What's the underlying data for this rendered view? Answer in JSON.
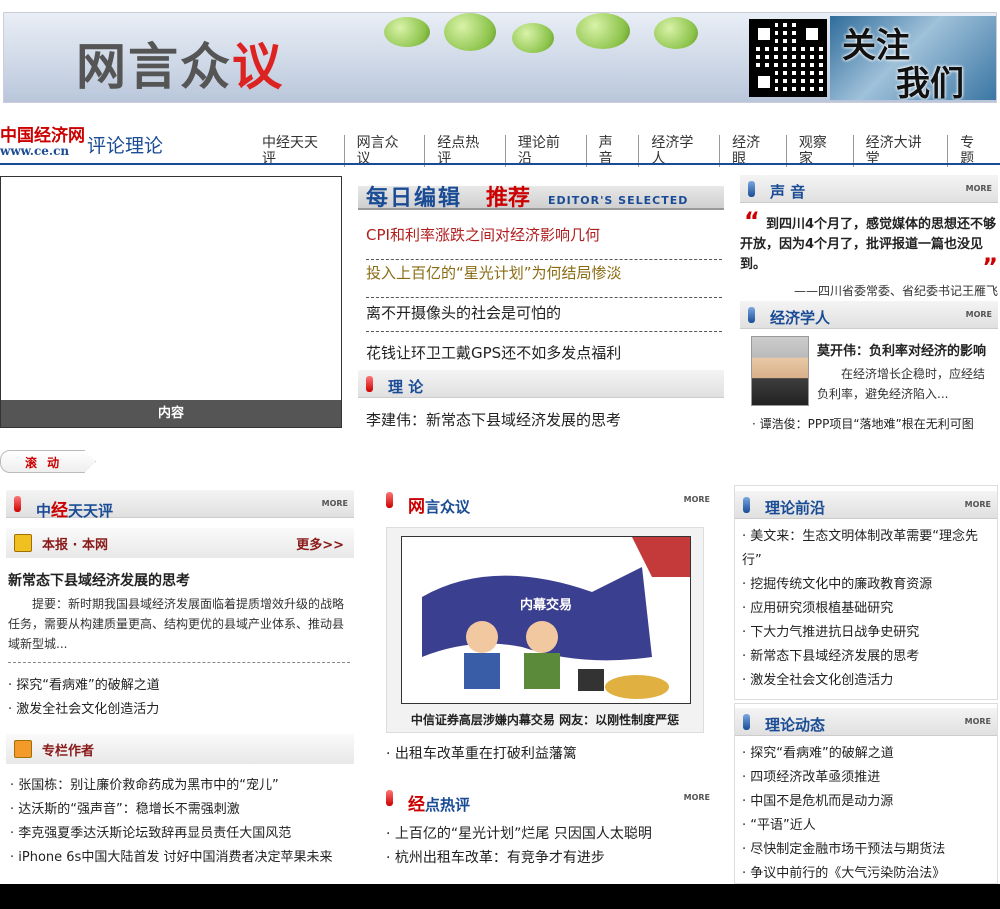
{
  "banner": {
    "title_a": "网言众",
    "title_b": "议",
    "follow_a": "关注",
    "follow_b": "我们"
  },
  "site": {
    "logo_cn": "中国经济网",
    "logo_url": "www.ce.cn",
    "section": "评论理论"
  },
  "topnav": [
    "中经天天评",
    "网言众议",
    "经点热评",
    "理论前沿",
    "声音",
    "经济学人",
    "经济眼",
    "观察家",
    "经济大讲堂",
    "专题"
  ],
  "photo": {
    "caption": "内容"
  },
  "editor": {
    "title_a": "每日编辑",
    "title_b": "推荐",
    "title_en": "Editor's Selected"
  },
  "headlines": [
    {
      "text": "CPI和利率涨跌之间对经济影响几何",
      "color": "#b01e1e"
    },
    {
      "text": "投入上百亿的“星光计划”为何结局惨淡",
      "color": "#8a6b12"
    },
    {
      "text": "离不开摄像头的社会是可怕的",
      "color": "#222222"
    },
    {
      "text": "花钱让环卫工戴GPS还不如多发点福利",
      "color": "#222222"
    }
  ],
  "theory": {
    "label": "理 论",
    "item": "李建伟：新常态下县域经济发展的思考"
  },
  "voice": {
    "label": "声 音",
    "more": "MORE",
    "quote": "到四川4个月了，感觉媒体的思想还不够开放，因为4个月了，批评报道一篇也没见到。",
    "by": "——四川省委常委、省纪委书记王雁飞"
  },
  "economist": {
    "label": "经济学人",
    "more": "MORE",
    "title": "莫开伟：负利率对经济的影响",
    "desc": "在经济增长企稳时，应经结负利率，避免经济陷入...",
    "item": "· 谭浩俊：PPP项目“落地难”根在无利可图"
  },
  "scroll": {
    "label": "滚 动"
  },
  "daily": {
    "label_r": "中",
    "label_r2": "经",
    "label": "天天评",
    "more": "MORE",
    "sub1": {
      "label": "本报 · 本网",
      "more": "更多>>"
    },
    "story_title": "新常态下县域经济发展的思考",
    "story_desc": "提要：新时期我国县域经济发展面临着提质增效升级的战略任务，需要从构建质量更高、结构更优的县域产业体系、推动县域新型城...",
    "items": [
      "· 探究“看病难”的破解之道",
      "· 激发全社会文化创造活力"
    ],
    "sub2": {
      "label": "专栏作者"
    },
    "columnists": [
      "· 张国栋：别让廉价救命药成为黑市中的“宠儿”",
      "· 达沃斯的“强声音”：稳增长不需强刺激",
      "· 李克强夏季达沃斯论坛致辞再显员责任大国风范",
      "· iPhone 6s中国大陆首发 讨好中国消费者决定苹果未来"
    ]
  },
  "wangyan": {
    "label_r": "网",
    "label": "言众议",
    "more": "MORE",
    "cartoon_title": "内幕交易",
    "caption": "中信证券高层涉嫌内幕交易 网友：以刚性制度严惩",
    "item": "· 出租车改革重在打破利益藩篱"
  },
  "hot": {
    "label_r": "经",
    "label": "点热评",
    "more": "MORE",
    "items": [
      "· 上百亿的“星光计划”烂尾 只因国人太聪明",
      "· 杭州出租车改革：有竞争才有进步"
    ]
  },
  "frontier": {
    "label": "理论前沿",
    "more": "MORE",
    "items": [
      "· 美文来：生态文明体制改革需要“理念先行”",
      "· 挖掘传统文化中的廉政教育资源",
      "· 应用研究须根植基础研究",
      "· 下大力气推进抗日战争史研究",
      "· 新常态下县域经济发展的思考",
      "· 激发全社会文化创造活力"
    ]
  },
  "dynamics": {
    "label": "理论动态",
    "more": "MORE",
    "items": [
      "· 探究“看病难”的破解之道",
      "· 四项经济改革亟须推进",
      "· 中国不是危机而是动力源",
      "· “平语”近人",
      "· 尽快制定金融市场干预法与期货法",
      "· 争议中前行的《大气污染防治法》"
    ]
  }
}
